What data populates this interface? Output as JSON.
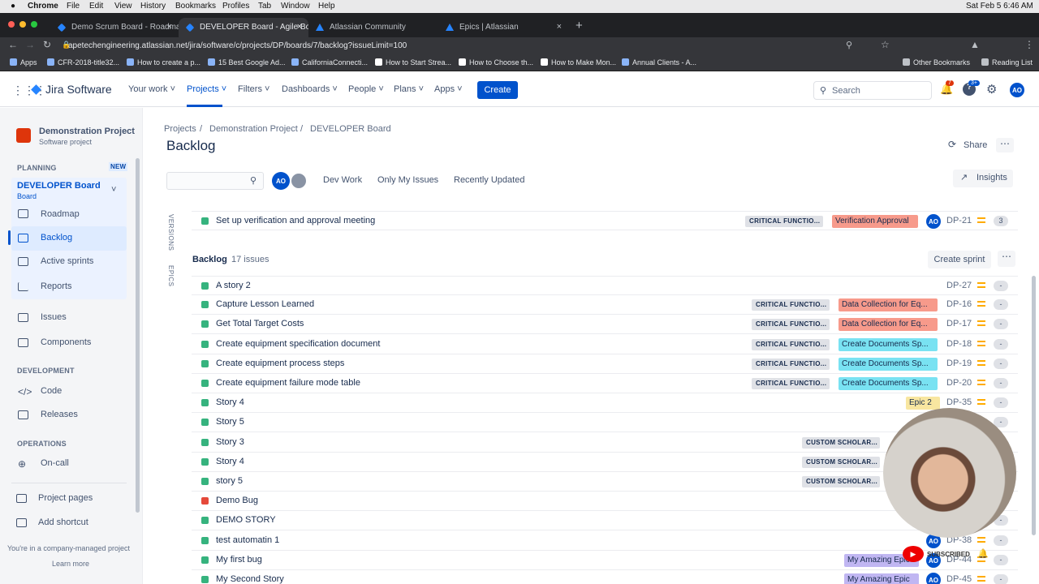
{
  "menubar": {
    "apple": "",
    "app": "Chrome",
    "items": [
      "File",
      "Edit",
      "View",
      "History",
      "Bookmarks",
      "Profiles",
      "Tab",
      "Window",
      "Help"
    ],
    "clock": "Sat Feb 5  6:46 AM"
  },
  "tabs": [
    {
      "title": "Demo Scrum Board - Roadmap"
    },
    {
      "title": "DEVELOPER Board - Agile Board"
    },
    {
      "title": "Atlassian Community"
    },
    {
      "title": "Epics | Atlassian"
    }
  ],
  "url": "apetechengineering.atlassian.net/jira/software/c/projects/DP/boards/7/backlog?issueLimit=100",
  "bookmarks": [
    "Apps",
    "CFR-2018-title32...",
    "How to create a p...",
    "15 Best Google Ad...",
    "CaliforniaConnecti...",
    "How to Start Strea...",
    "How to Choose th...",
    "How to Make Mon...",
    "Annual Clients - A...",
    "Other Bookmarks",
    "Reading List"
  ],
  "topnav": {
    "product": "Jira Software",
    "items": [
      "Your work",
      "Projects",
      "Filters",
      "Dashboards",
      "People",
      "Plans",
      "Apps"
    ],
    "create": "Create",
    "search": "Search",
    "notif_count": "7",
    "help_count": "3+",
    "avatar": "AO"
  },
  "sidebar": {
    "project_name": "Demonstration Project",
    "project_type": "Software project",
    "planning": "PLANNING",
    "new_badge": "NEW",
    "board_name": "DEVELOPER Board",
    "board_sub": "Board",
    "items": [
      "Roadmap",
      "Backlog",
      "Active sprints",
      "Reports",
      "Issues",
      "Components"
    ],
    "development": "DEVELOPMENT",
    "dev_items": [
      "Code",
      "Releases"
    ],
    "operations": "OPERATIONS",
    "ops_items": [
      "On-call"
    ],
    "footer_items": [
      "Project pages",
      "Add shortcut"
    ],
    "managed_note": "You're in a company-managed project",
    "learn_more": "Learn more"
  },
  "breadcrumb": [
    "Projects",
    "Demonstration Project",
    "DEVELOPER Board"
  ],
  "page_title": "Backlog",
  "header_actions": {
    "share": "Share",
    "insights": "Insights"
  },
  "filters": {
    "avatar": "AO",
    "quick": [
      "Dev Work",
      "Only My Issues",
      "Recently Updated"
    ]
  },
  "side_tabs": [
    "VERSIONS",
    "EPICS"
  ],
  "sprint_row": {
    "summary": "Set up verification and approval meeting",
    "label": "CRITICAL FUNCTIO...",
    "epic": "Verification Approval",
    "avatar": "AO",
    "key": "DP-21",
    "estimate": "3"
  },
  "backlog": {
    "title": "Backlog",
    "count": "17 issues",
    "create_sprint": "Create sprint",
    "rows": [
      {
        "summary": "A story 2",
        "label": "",
        "epic": "",
        "key": "DP-27",
        "est": "-",
        "type": "story"
      },
      {
        "summary": "Capture Lesson Learned",
        "label": "CRITICAL FUNCTIO...",
        "epic": "Data Collection for Eq...",
        "key": "DP-16",
        "est": "-",
        "type": "story"
      },
      {
        "summary": "Get Total Target Costs",
        "label": "CRITICAL FUNCTIO...",
        "epic": "Data Collection for Eq...",
        "key": "DP-17",
        "est": "-",
        "type": "story"
      },
      {
        "summary": "Create equipment specification document",
        "label": "CRITICAL FUNCTIO...",
        "epic": "Create Documents Sp...",
        "key": "DP-18",
        "est": "-",
        "type": "story"
      },
      {
        "summary": "Create equipment process steps",
        "label": "CRITICAL FUNCTIO...",
        "epic": "Create Documents Sp...",
        "key": "DP-19",
        "est": "-",
        "type": "story"
      },
      {
        "summary": "Create equipment failure mode table",
        "label": "CRITICAL FUNCTIO...",
        "epic": "Create Documents Sp...",
        "key": "DP-20",
        "est": "-",
        "type": "story"
      },
      {
        "summary": "Story 4",
        "label": "",
        "epic": "Epic 2",
        "key": "DP-35",
        "est": "-",
        "type": "story"
      },
      {
        "summary": "Story 5",
        "label": "",
        "epic": "",
        "key": "",
        "est": "-",
        "type": "story"
      },
      {
        "summary": "Story 3",
        "label": "CUSTOM SCHOLAR...",
        "epic": "",
        "key": "",
        "est": "",
        "type": "story"
      },
      {
        "summary": "Story 4",
        "label": "CUSTOM SCHOLAR...",
        "epic": "",
        "key": "",
        "est": "",
        "type": "story"
      },
      {
        "summary": "story 5",
        "label": "CUSTOM SCHOLAR...",
        "epic": "",
        "key": "",
        "est": "",
        "type": "story"
      },
      {
        "summary": "Demo Bug",
        "label": "",
        "epic": "",
        "key": "",
        "est": "",
        "type": "bug"
      },
      {
        "summary": "DEMO STORY",
        "label": "",
        "epic": "",
        "key": "",
        "est": "-",
        "type": "story"
      },
      {
        "summary": "test automatin 1",
        "label": "",
        "epic": "",
        "key": "DP-38",
        "est": "-",
        "type": "story"
      },
      {
        "summary": "My first bug",
        "label": "",
        "epic": "My Amazing Epic",
        "key": "DP-44",
        "est": "-",
        "type": "story"
      },
      {
        "summary": "My Second Story",
        "label": "",
        "epic": "My Amazing Epic",
        "key": "DP-45",
        "est": "-",
        "type": "story"
      }
    ]
  },
  "overlay": {
    "subscribed": "SUBSCRIBED"
  },
  "colors": {
    "primary": "#0052CC",
    "epic_red": "#F79A8B",
    "epic_teal": "#79E2F2",
    "epic_yellow": "#F8E6A0",
    "epic_purple": "#C0B6F2"
  }
}
